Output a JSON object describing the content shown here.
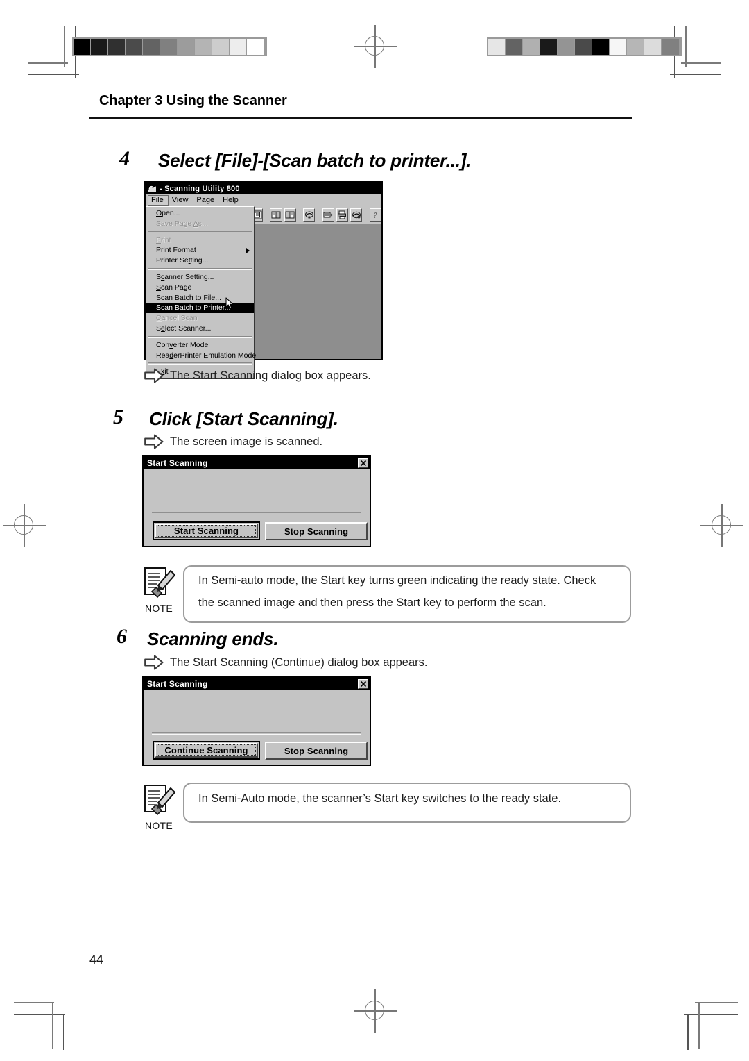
{
  "page": {
    "chapter_heading": "Chapter 3 Using the Scanner",
    "page_number": "44"
  },
  "steps": [
    {
      "number": "4",
      "title": "Select [File]-[Scan batch to printer...].",
      "result": "The Start Scanning dialog box appears.",
      "result_arrow_icon": "arrow-right-outline-icon"
    },
    {
      "number": "5",
      "title": "Click [Start Scanning].",
      "result": "The screen image is scanned.",
      "result_arrow_icon": "arrow-right-outline-icon"
    },
    {
      "number": "6",
      "title": "Scanning ends.",
      "result": "The Start Scanning (Continue) dialog box appears.",
      "result_arrow_icon": "arrow-right-outline-icon"
    }
  ],
  "scanning_utility_window": {
    "title": "- Scanning Utility 800",
    "title_icon": "scanner-app-icon",
    "menubar": [
      {
        "label": "File",
        "accel": "F",
        "active": true
      },
      {
        "label": "View",
        "accel": "V",
        "active": false
      },
      {
        "label": "Page",
        "accel": "P",
        "active": false
      },
      {
        "label": "Help",
        "accel": "H",
        "active": false
      }
    ],
    "toolbar_buttons": [
      "page-view-icon",
      "book-left-icon",
      "book-right-icon",
      "scan-page-icon",
      "scan-batch-file-icon",
      "scan-batch-printer-icon",
      "print-icon",
      "help-icon"
    ],
    "file_menu": [
      {
        "label": "Open...",
        "accel": "O",
        "state": "normal"
      },
      {
        "label": "Save Page As...",
        "accel": "A",
        "state": "disabled"
      },
      {
        "separator": true
      },
      {
        "label": "Print",
        "accel": "P",
        "state": "disabled"
      },
      {
        "label": "Print Format",
        "accel": "F",
        "state": "normal",
        "submenu": true
      },
      {
        "label": "Printer Setting...",
        "accel": "t",
        "state": "normal"
      },
      {
        "separator": true
      },
      {
        "label": "Scanner Setting...",
        "accel": "c",
        "state": "normal"
      },
      {
        "label": "Scan Page",
        "accel": "S",
        "state": "normal"
      },
      {
        "label": "Scan Batch to File...",
        "accel": "B",
        "state": "normal"
      },
      {
        "label": "Scan Batch to Printer...",
        "accel": "B",
        "state": "selected"
      },
      {
        "label": "Cancel Scan",
        "accel": "C",
        "state": "disabled"
      },
      {
        "label": "Select Scanner...",
        "accel": "e",
        "state": "normal"
      },
      {
        "separator": true
      },
      {
        "label": "Converter Mode",
        "accel": "v",
        "state": "normal"
      },
      {
        "label": "ReaderPrinter Emulation Mode",
        "accel": "d",
        "state": "normal"
      },
      {
        "separator": true
      },
      {
        "label": "Exit",
        "accel": "x",
        "state": "normal"
      }
    ],
    "mouse_cursor_icon": "mouse-pointer-icon"
  },
  "start_scanning_dialog": {
    "title": "Start Scanning",
    "close_button_label": "✕",
    "close_button_icon": "close-icon",
    "primary_button": "Start Scanning",
    "secondary_button": "Stop Scanning"
  },
  "continue_scanning_dialog": {
    "title": "Start Scanning",
    "close_button_label": "✕",
    "close_button_icon": "close-icon",
    "primary_button": "Continue Scanning",
    "secondary_button": "Stop Scanning"
  },
  "notes": [
    {
      "label": "NOTE",
      "icon": "note-pencil-icon",
      "line1": "In Semi-auto mode, the Start key turns green indicating the ready state. Check",
      "line2": "the scanned image and then press the Start key to perform the scan."
    },
    {
      "label": "NOTE",
      "icon": "note-pencil-icon",
      "line1": "In Semi-Auto mode, the scanner’s Start key switches to the ready state.",
      "line2": ""
    }
  ],
  "calibration": {
    "left_bar_icon": "grayscale-step-wedge",
    "left_bar_swatches": [
      "#000000",
      "#191919",
      "#303030",
      "#4b4b4b",
      "#636363",
      "#808080",
      "#9c9c9c",
      "#b4b4b4",
      "#cdcdcd",
      "#ededed",
      "#ffffff"
    ],
    "right_bar_icon": "grayscale-scrambled-patches",
    "right_bar_swatches": [
      "#e6e6e6",
      "#636363",
      "#b0b0b0",
      "#1a1a1a",
      "#949494",
      "#4a4a4a",
      "#000000",
      "#f6f6f6",
      "#b6b6b6",
      "#dcdcdc",
      "#808080"
    ],
    "registration_mark_icon": "registration-target-icon",
    "crop_mark_icon": "crop-corner-icon"
  }
}
